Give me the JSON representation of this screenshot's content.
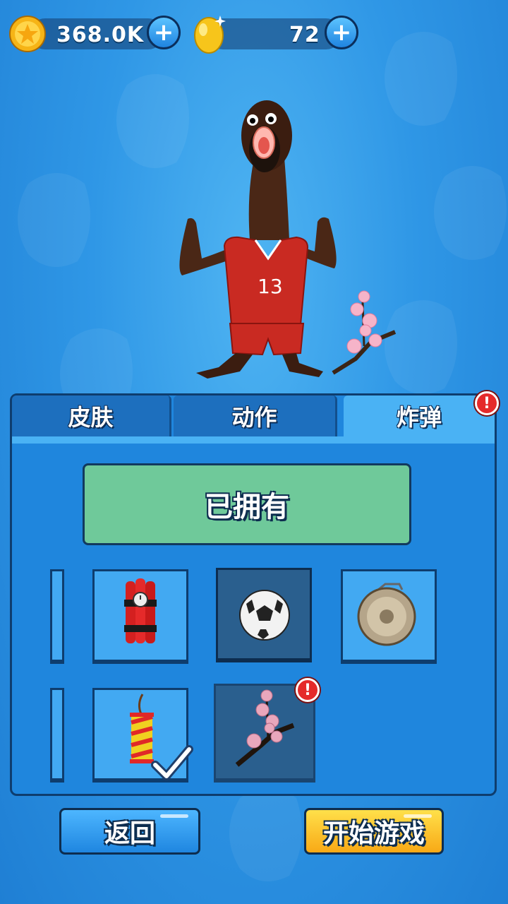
{
  "currency": {
    "coins": {
      "icon": "star-coin-icon",
      "amount": "368.0K"
    },
    "eggs": {
      "icon": "golden-egg-icon",
      "amount": "72"
    }
  },
  "character": {
    "jersey_number": "13",
    "accessory": "cherry-blossom-branch"
  },
  "tabs": [
    {
      "label": "皮肤",
      "active": false
    },
    {
      "label": "动作",
      "active": false
    },
    {
      "label": "炸弹",
      "active": true,
      "alert": "!"
    }
  ],
  "status_banner": "已拥有",
  "items": [
    {
      "name": "dynamite-bundle-icon",
      "state": "owned"
    },
    {
      "name": "soccer-ball-icon",
      "state": "selected"
    },
    {
      "name": "gong-icon",
      "state": "owned"
    },
    {
      "name": "firecracker-icon",
      "state": "equipped"
    },
    {
      "name": "cherry-blossom-branch-icon",
      "state": "new",
      "alert": "!"
    }
  ],
  "buttons": {
    "back": "返回",
    "start": "开始游戏"
  },
  "colors": {
    "panel": "#1f86dd",
    "active_tab": "#4ab2f4",
    "owned_banner": "#6fc99a",
    "start_button": "#f8a916"
  }
}
